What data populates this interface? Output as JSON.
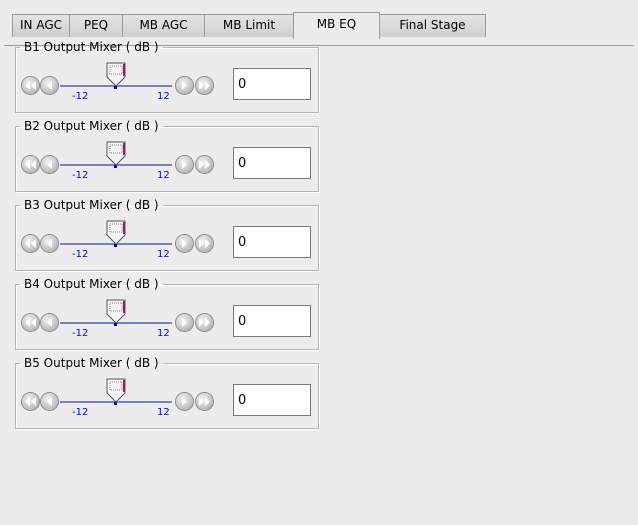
{
  "tabs": [
    {
      "label": "IN AGC",
      "active": false
    },
    {
      "label": "PEQ",
      "active": false
    },
    {
      "label": "MB AGC",
      "active": false
    },
    {
      "label": "MB Limit",
      "active": false
    },
    {
      "label": "MB EQ",
      "active": true
    },
    {
      "label": "Final Stage",
      "active": false
    }
  ],
  "mixers": [
    {
      "title": "B1 Output Mixer ( dB )",
      "min_label": "-12",
      "max_label": "12",
      "value": "0"
    },
    {
      "title": "B2 Output Mixer ( dB )",
      "min_label": "-12",
      "max_label": "12",
      "value": "0"
    },
    {
      "title": "B3 Output Mixer ( dB )",
      "min_label": "-12",
      "max_label": "12",
      "value": "0"
    },
    {
      "title": "B4 Output Mixer ( dB )",
      "min_label": "-12",
      "max_label": "12",
      "value": "0"
    },
    {
      "title": "B5 Output Mixer ( dB )",
      "min_label": "-12",
      "max_label": "12",
      "value": "0"
    }
  ],
  "icons": {
    "fast_back": "double-left-arrow-icon",
    "back": "left-arrow-icon",
    "forward": "right-arrow-icon",
    "fast_forward": "double-right-arrow-icon",
    "thumb": "slider-thumb-icon"
  },
  "colors": {
    "track": "#7c7fbf",
    "tick_label": "#0000ff",
    "thumb_marker": "#b01060",
    "background": "#ececec"
  }
}
